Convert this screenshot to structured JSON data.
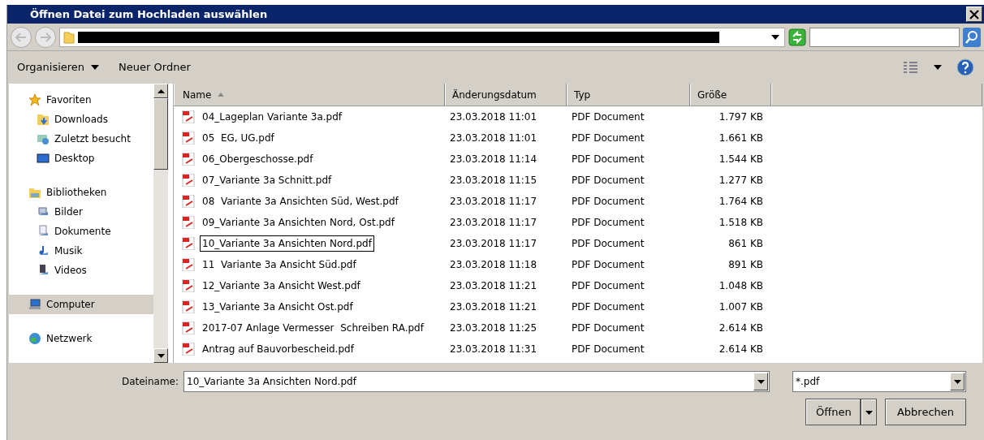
{
  "window": {
    "title": "Öffnen Datei zum Hochladen auswählen"
  },
  "toolbar": {
    "items": [
      {
        "label": "Organisieren",
        "kind": "menu"
      },
      {
        "label": "Neuer Ordner",
        "kind": "button"
      }
    ]
  },
  "sidebar": {
    "items": [
      {
        "label": "Favoriten",
        "selected": false,
        "children": [
          {
            "label": "Downloads",
            "selected": false
          },
          {
            "label": "Zuletzt besucht",
            "selected": false
          },
          {
            "label": "Desktop",
            "selected": false
          }
        ]
      },
      {
        "label": "Bibliotheken",
        "selected": false,
        "children": [
          {
            "label": "Bilder",
            "selected": false
          },
          {
            "label": "Dokumente",
            "selected": false
          },
          {
            "label": "Musik",
            "selected": false
          },
          {
            "label": "Videos",
            "selected": false
          }
        ]
      },
      {
        "label": "Computer",
        "selected": true
      },
      {
        "label": "Netzwerk",
        "selected": false
      }
    ]
  },
  "table": {
    "columns": [
      {
        "label": "Name",
        "sorted": true
      },
      {
        "label": "Änderungsdatum",
        "sorted": false
      },
      {
        "label": "Typ",
        "sorted": false
      },
      {
        "label": "Größe",
        "sorted": false
      }
    ],
    "rows": [
      {
        "name": "04_Lageplan Variante 3a.pdf",
        "date": "23.03.2018 11:01",
        "type": "PDF Document",
        "size": "1.797 KB",
        "selected": false
      },
      {
        "name": "05  EG, UG.pdf",
        "date": "23.03.2018 11:01",
        "type": "PDF Document",
        "size": "1.661 KB",
        "selected": false
      },
      {
        "name": "06_Obergeschosse.pdf",
        "date": "23.03.2018 11:14",
        "type": "PDF Document",
        "size": "1.544 KB",
        "selected": false
      },
      {
        "name": "07_Variante 3a Schnitt.pdf",
        "date": "23.03.2018 11:15",
        "type": "PDF Document",
        "size": "1.277 KB",
        "selected": false
      },
      {
        "name": "08  Variante 3a Ansichten Süd, West.pdf",
        "date": "23.03.2018 11:17",
        "type": "PDF Document",
        "size": "1.764 KB",
        "selected": false
      },
      {
        "name": "09_Variante 3a Ansichten Nord, Ost.pdf",
        "date": "23.03.2018 11:17",
        "type": "PDF Document",
        "size": "1.518 KB",
        "selected": false
      },
      {
        "name": "10_Variante 3a Ansichten Nord.pdf",
        "date": "23.03.2018 11:17",
        "type": "PDF Document",
        "size": "861 KB",
        "selected": true
      },
      {
        "name": "11  Variante 3a Ansicht Süd.pdf",
        "date": "23.03.2018 11:18",
        "type": "PDF Document",
        "size": "891 KB",
        "selected": false
      },
      {
        "name": "12_Variante 3a Ansicht West.pdf",
        "date": "23.03.2018 11:21",
        "type": "PDF Document",
        "size": "1.048 KB",
        "selected": false
      },
      {
        "name": "13_Variante 3a Ansicht Ost.pdf",
        "date": "23.03.2018 11:21",
        "type": "PDF Document",
        "size": "1.007 KB",
        "selected": false
      },
      {
        "name": "2017-07 Anlage Vermesser  Schreiben RA.pdf",
        "date": "23.03.2018 11:25",
        "type": "PDF Document",
        "size": "2.614 KB",
        "selected": false
      },
      {
        "name": "Antrag auf Bauvorbescheid.pdf",
        "date": "23.03.2018 11:31",
        "type": "PDF Document",
        "size": "2.614 KB",
        "selected": false
      }
    ]
  },
  "footer": {
    "filename_label": "Dateiname:",
    "filename": "10_Variante 3a Ansichten Nord.pdf",
    "filter": "*.pdf",
    "open_button": "Öffnen",
    "cancel_button": "Abbrechen"
  }
}
